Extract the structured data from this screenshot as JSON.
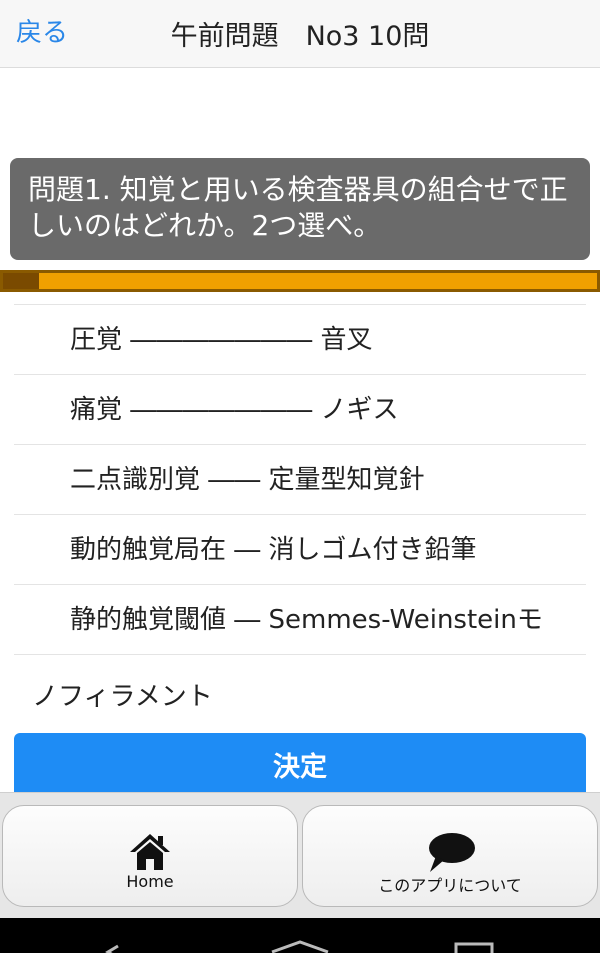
{
  "header": {
    "back_label": "戻る",
    "title": "午前問題　No3 10問"
  },
  "question": {
    "text": "問題1. 知覚と用いる検査器具の組合せで正しいのはどれか。2つ選べ。"
  },
  "progress": {
    "value": 0.06
  },
  "choices": [
    {
      "label": "圧覚 ――――――― 音叉"
    },
    {
      "label": "痛覚 ――――――― ノギス"
    },
    {
      "label": "二点識別覚 ―― 定量型知覚針"
    },
    {
      "label": "動的触覚局在 ― 消しゴム付き鉛筆"
    },
    {
      "label": "静的触覚閾値 ― Semmes-Weinsteinモ"
    }
  ],
  "choice_overflow": "ノフィラメント",
  "decide_label": "決定",
  "tabs": [
    {
      "label": "Home",
      "icon": "home-icon"
    },
    {
      "label": "このアプリについて",
      "icon": "speech-bubble-icon"
    }
  ],
  "colors": {
    "accent": "#1e8cf5",
    "back_link": "#2a87e8",
    "progress": "#f0a000",
    "progress_fill": "#7a4a00",
    "question_bg": "#6a6a6a"
  }
}
